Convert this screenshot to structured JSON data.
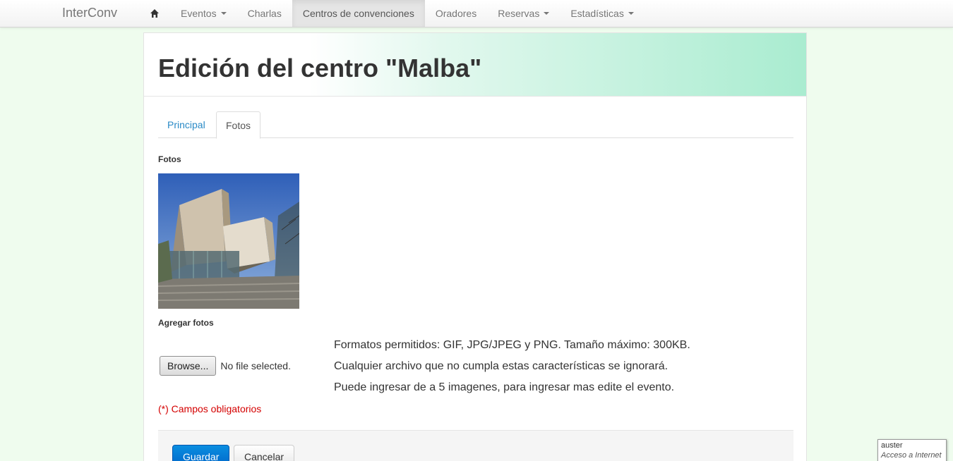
{
  "navbar": {
    "brand": "InterConv",
    "home_icon": "home-icon",
    "items": [
      {
        "label": "Eventos",
        "dropdown": true,
        "active": false
      },
      {
        "label": "Charlas",
        "dropdown": false,
        "active": false
      },
      {
        "label": "Centros de convenciones",
        "dropdown": false,
        "active": true
      },
      {
        "label": "Oradores",
        "dropdown": false,
        "active": false
      },
      {
        "label": "Reservas",
        "dropdown": true,
        "active": false
      },
      {
        "label": "Estadísticas",
        "dropdown": true,
        "active": false
      }
    ]
  },
  "page": {
    "title": "Edición del centro \"Malba\"",
    "tabs": [
      {
        "label": "Principal",
        "active": false
      },
      {
        "label": "Fotos",
        "active": true
      }
    ],
    "photos_label": "Fotos",
    "add_photos_label": "Agregar fotos",
    "browse_button": "Browse...",
    "file_status": "No file selected.",
    "help_lines": [
      "Formatos permitidos: GIF, JPG/JPEG y PNG. Tamaño máximo: 300KB.",
      "Cualquier archivo que no cumpla estas características se ignorará.",
      "Puede ingresar de a 5 imagenes, para ingresar mas edite el evento."
    ],
    "required_note": "(*) Campos obligatorios",
    "save_button": "Guardar",
    "cancel_button": "Cancelar"
  },
  "status_popup": {
    "user": "auster",
    "zone": "Acceso a Internet"
  },
  "colors": {
    "accent": "#2a8ac6",
    "primary_button": "#0a7bd6",
    "required": "#d40000",
    "background": "#effcee",
    "header_gradient_end": "#a9ecd0"
  }
}
